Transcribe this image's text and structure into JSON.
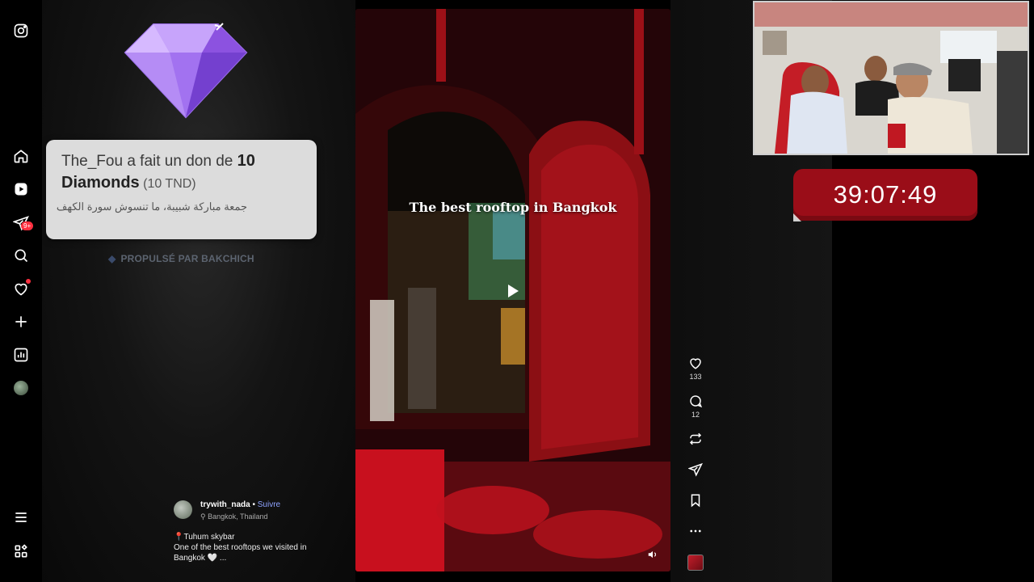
{
  "donation": {
    "donor": "The_Fou",
    "action": " a fait un don de ",
    "amount": "10 Diamonds",
    "converted": " (10 TND)",
    "message": "جمعة مباركة شبيبة، ما تنسوش سورة الكهف",
    "powered_by": "PROPULSÉ PAR BAKCHICH"
  },
  "sidebar": {
    "notification_badge": "9+",
    "icons": [
      "instagram-icon",
      "home-icon",
      "reels-icon",
      "messages-icon",
      "search-icon",
      "notifications-icon",
      "create-icon",
      "dashboard-icon",
      "profile-avatar",
      "menu-icon",
      "more-icon"
    ]
  },
  "video": {
    "caption": "The best rooftop in Bangkok"
  },
  "actions": {
    "likes": "133",
    "comments": "12"
  },
  "post": {
    "username": "trywith_nada",
    "separator": " • ",
    "follow": "Suivre",
    "location": "Bangkok, Thailand",
    "caption_line1": "📍Tuhum skybar",
    "caption_line2": "One of the best rooftops we visited in Bangkok 🤍 ..."
  },
  "stream": {
    "timer": "39:07:49"
  },
  "colors": {
    "accent_red": "#ff3040",
    "timer_red": "#9a0d18",
    "follow_blue": "#8fa3ff"
  }
}
